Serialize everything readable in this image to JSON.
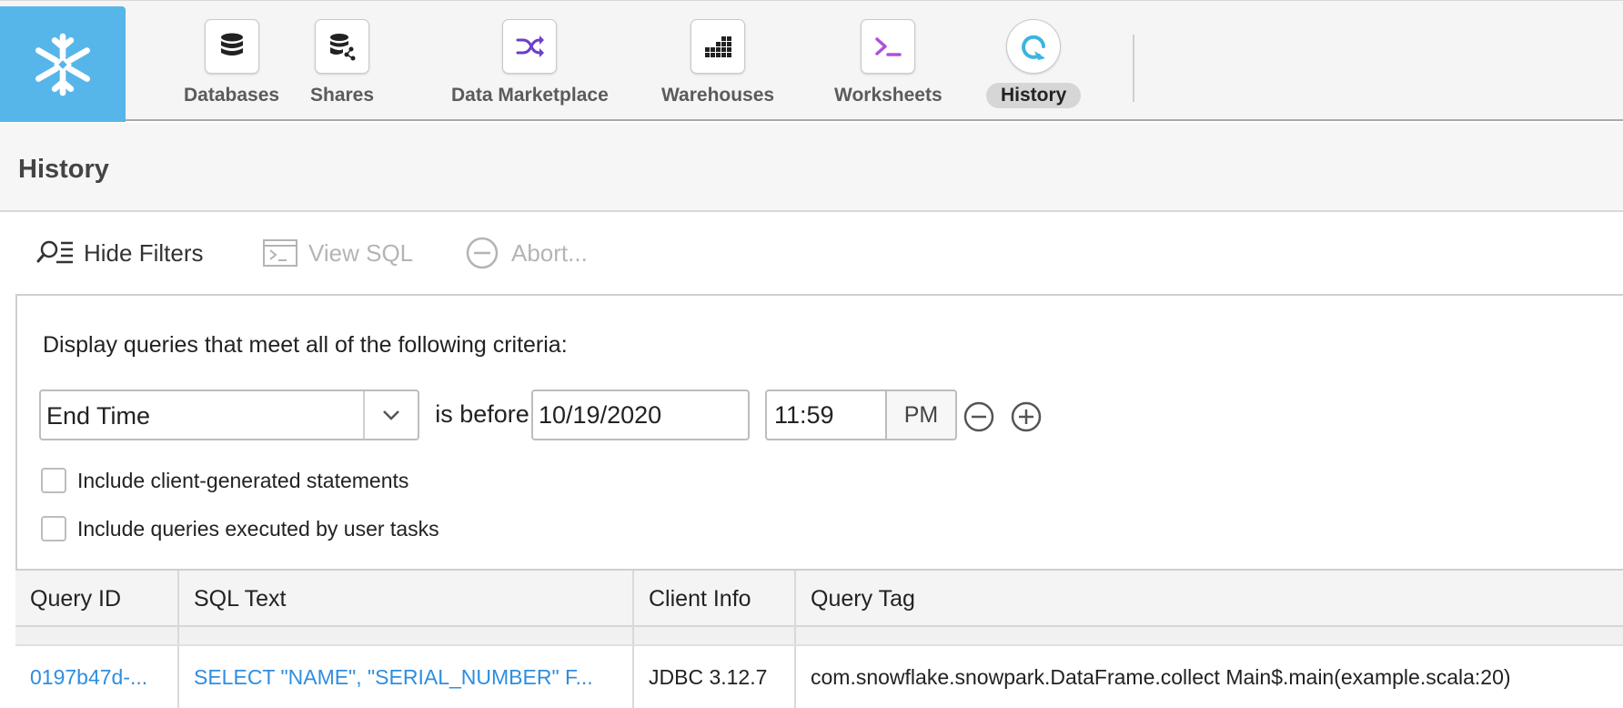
{
  "nav": {
    "items": [
      {
        "label": "Databases",
        "icon": "database-icon"
      },
      {
        "label": "Shares",
        "icon": "share-database-icon"
      },
      {
        "label": "Data Marketplace",
        "icon": "shuffle-icon"
      },
      {
        "label": "Warehouses",
        "icon": "warehouse-grid-icon"
      },
      {
        "label": "Worksheets",
        "icon": "terminal-icon"
      },
      {
        "label": "History",
        "icon": "history-refresh-icon",
        "active": true
      }
    ],
    "brand_color": "#56b6e9"
  },
  "page": {
    "title": "History"
  },
  "toolbar": {
    "hide_filters": "Hide Filters",
    "view_sql": "View SQL",
    "abort": "Abort..."
  },
  "filters": {
    "criteria_text": "Display queries that meet all of the following criteria:",
    "field": "End Time",
    "operator": "is before",
    "date": "10/19/2020",
    "time": "11:59",
    "ampm": "PM",
    "checkboxes": [
      {
        "label": "Include client-generated statements",
        "checked": false
      },
      {
        "label": "Include queries executed by user tasks",
        "checked": false
      }
    ]
  },
  "table": {
    "columns": [
      "Query ID",
      "SQL Text",
      "Client Info",
      "Query Tag"
    ],
    "rows": [
      {
        "query_id": "0197b47d-...",
        "sql_text": "SELECT \"NAME\", \"SERIAL_NUMBER\" F...",
        "client_info": "JDBC 3.12.7",
        "query_tag": "com.snowflake.snowpark.DataFrame.collect Main$.main(example.scala:20)"
      }
    ]
  },
  "colors": {
    "link": "#2f8ee0",
    "accent": "#3db4e0",
    "purple_icon": "#8a4fd6"
  }
}
